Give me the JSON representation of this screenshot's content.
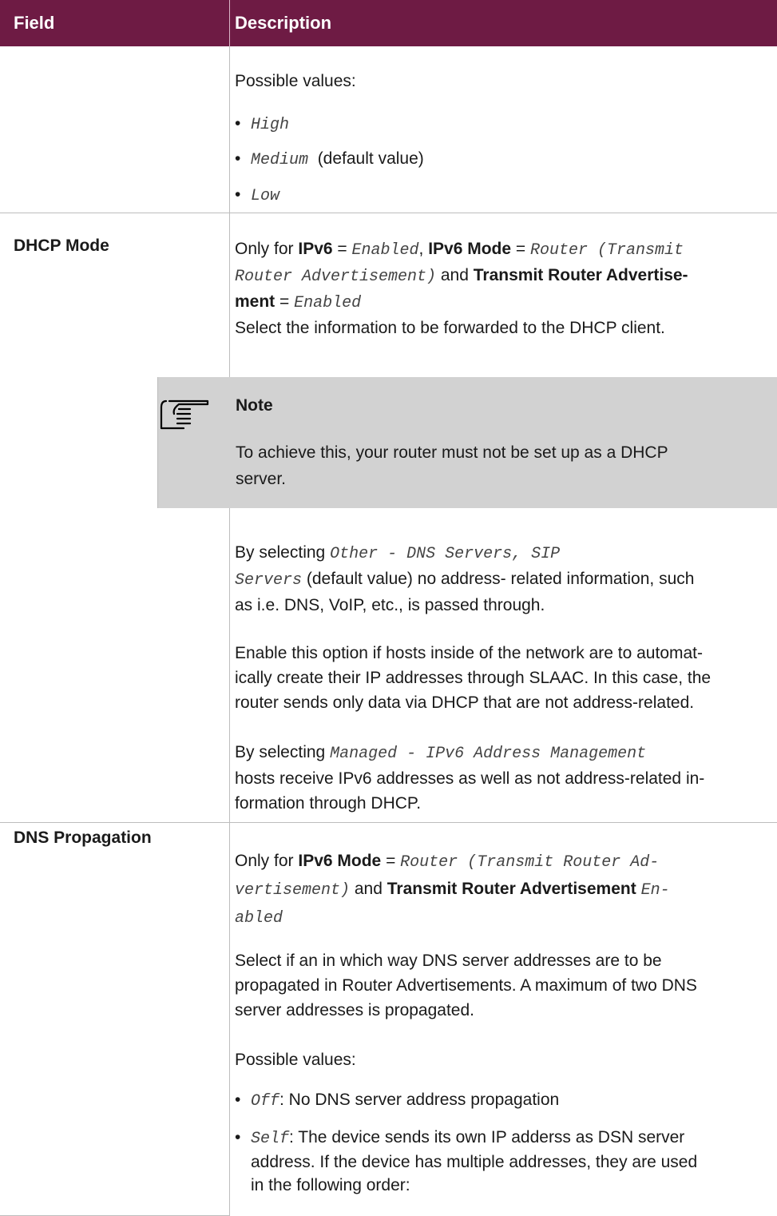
{
  "header": {
    "field": "Field",
    "description": "Description"
  },
  "row1": {
    "possible_values": "Possible values:",
    "v1": "High",
    "v2": "Medium",
    "v2_suffix": "(default value)",
    "v3": "Low"
  },
  "dhcp": {
    "field": "DHCP Mode",
    "line1_a": "Only for ",
    "line1_b": "IPv6",
    "line1_c": " = ",
    "line1_d": "Enabled",
    "line1_e": ", ",
    "line1_f": "IPv6 Mode",
    "line1_g": " = ",
    "line1_h": "Router (Transmit",
    "line2_a": "Router Advertisement)",
    "line2_b": " and ",
    "line2_c": "Transmit Router Advertise-",
    "line3_a": "ment",
    "line3_b": " = ",
    "line3_c": "Enabled",
    "line4": "Select the information to be forwarded to the DHCP client.",
    "note_title": "Note",
    "note_line1": "To achieve this, your router must not be set up as a DHCP",
    "note_line2": "server.",
    "p1_l1a": "By selecting ",
    "p1_l1b": "Other - DNS Servers, SIP",
    "p1_l2a": "Servers",
    "p1_l2b": " (default value) no address- related information, such",
    "p1_l3": "as i.e. DNS, VoIP, etc., is passed through.",
    "p2_l1": "Enable this option if hosts inside of the network are to automat-",
    "p2_l2": "ically create their IP addresses through SLAAC. In this case, the",
    "p2_l3": "router sends only data via DHCP that are not address-related.",
    "p3_l1a": "By selecting ",
    "p3_l1b": "Managed - IPv6 Address Management",
    "p3_l2": "hosts receive IPv6 addresses as well as not address-related in-",
    "p3_l3": "formation through DHCP."
  },
  "dns": {
    "field": "DNS Propagation",
    "l1_a": "Only for ",
    "l1_b": "IPv6 Mode",
    "l1_c": " = ",
    "l1_d": "Router (Transmit Router Ad-",
    "l2_a": "vertisement)",
    "l2_b": " and ",
    "l2_c": "Transmit Router Advertisement",
    "l2_d": "En-",
    "l3": "abled",
    "p1_l1": "Select if an in which way DNS server addresses are to be",
    "p1_l2": "propagated in Router Advertisements. A maximum of two DNS",
    "p1_l3": "server addresses is propagated.",
    "possible_values": "Possible values:",
    "o1_a": "Off",
    "o1_b": ": No DNS server address propagation",
    "o2_a": "Self",
    "o2_b": ": The device sends its own IP adderss as DSN server",
    "o2_l2": "address. If the device has multiple addresses, they are used",
    "o2_l3": "in the following order:"
  }
}
